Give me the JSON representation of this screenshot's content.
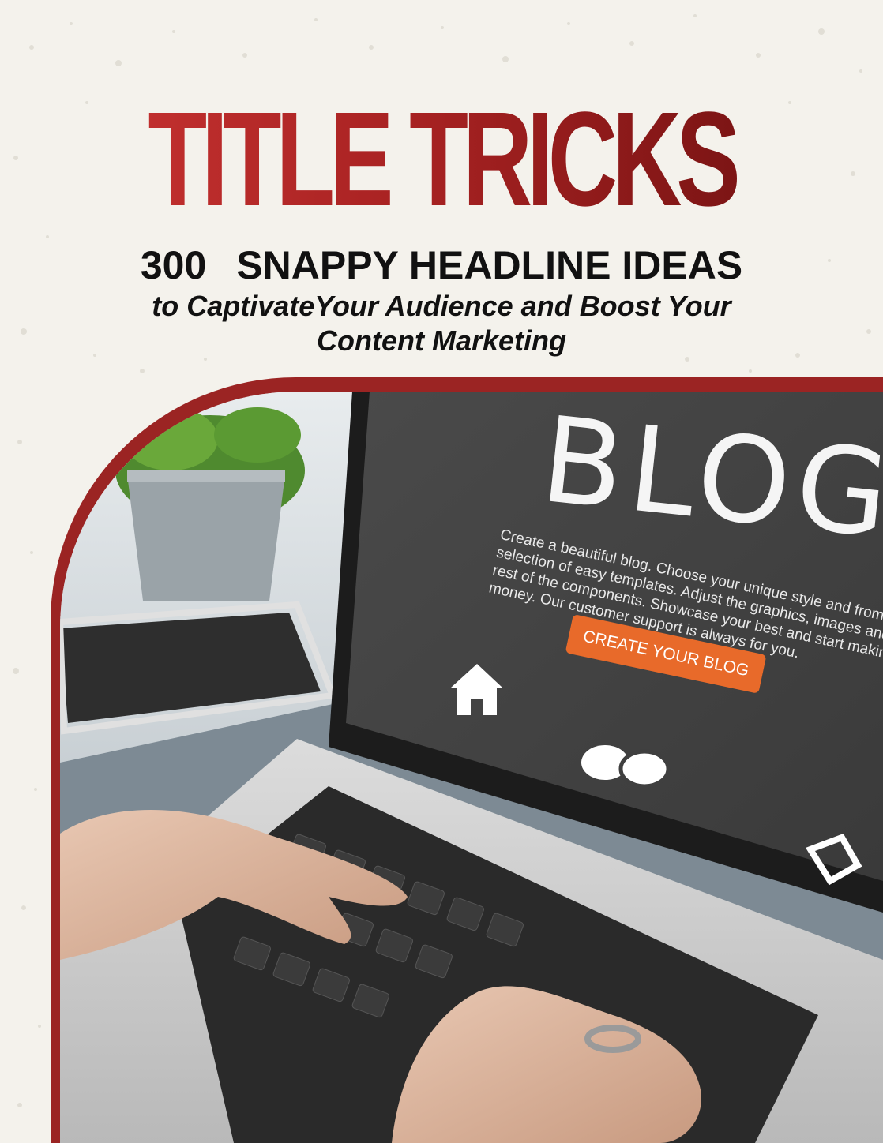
{
  "cover": {
    "title": "TITLE TRICKS",
    "subtitle_number": "300",
    "subtitle_text": "SNAPPY HEADLINE IDEAS",
    "tagline_line1": "to CaptivateYour Audience and Boost Your",
    "tagline_line2": "Content Marketing"
  },
  "photo": {
    "screen_heading": "BLOG",
    "screen_body": "Create a beautiful blog. Choose your unique style and from selection of easy templates. Adjust the graphics, images and the rest of the components. Showcase your best and start making money. Our customer support is always for you.",
    "cta_label": "CREATE YOUR BLOG",
    "icons": [
      "home-icon",
      "chat-bubbles-icon",
      "edit-icon"
    ]
  },
  "colors": {
    "title_red": "#c2302f",
    "title_dark_red": "#7a1414",
    "frame_red": "#9b2423",
    "cta_orange": "#e86a2a",
    "background": "#f4f2ec"
  }
}
